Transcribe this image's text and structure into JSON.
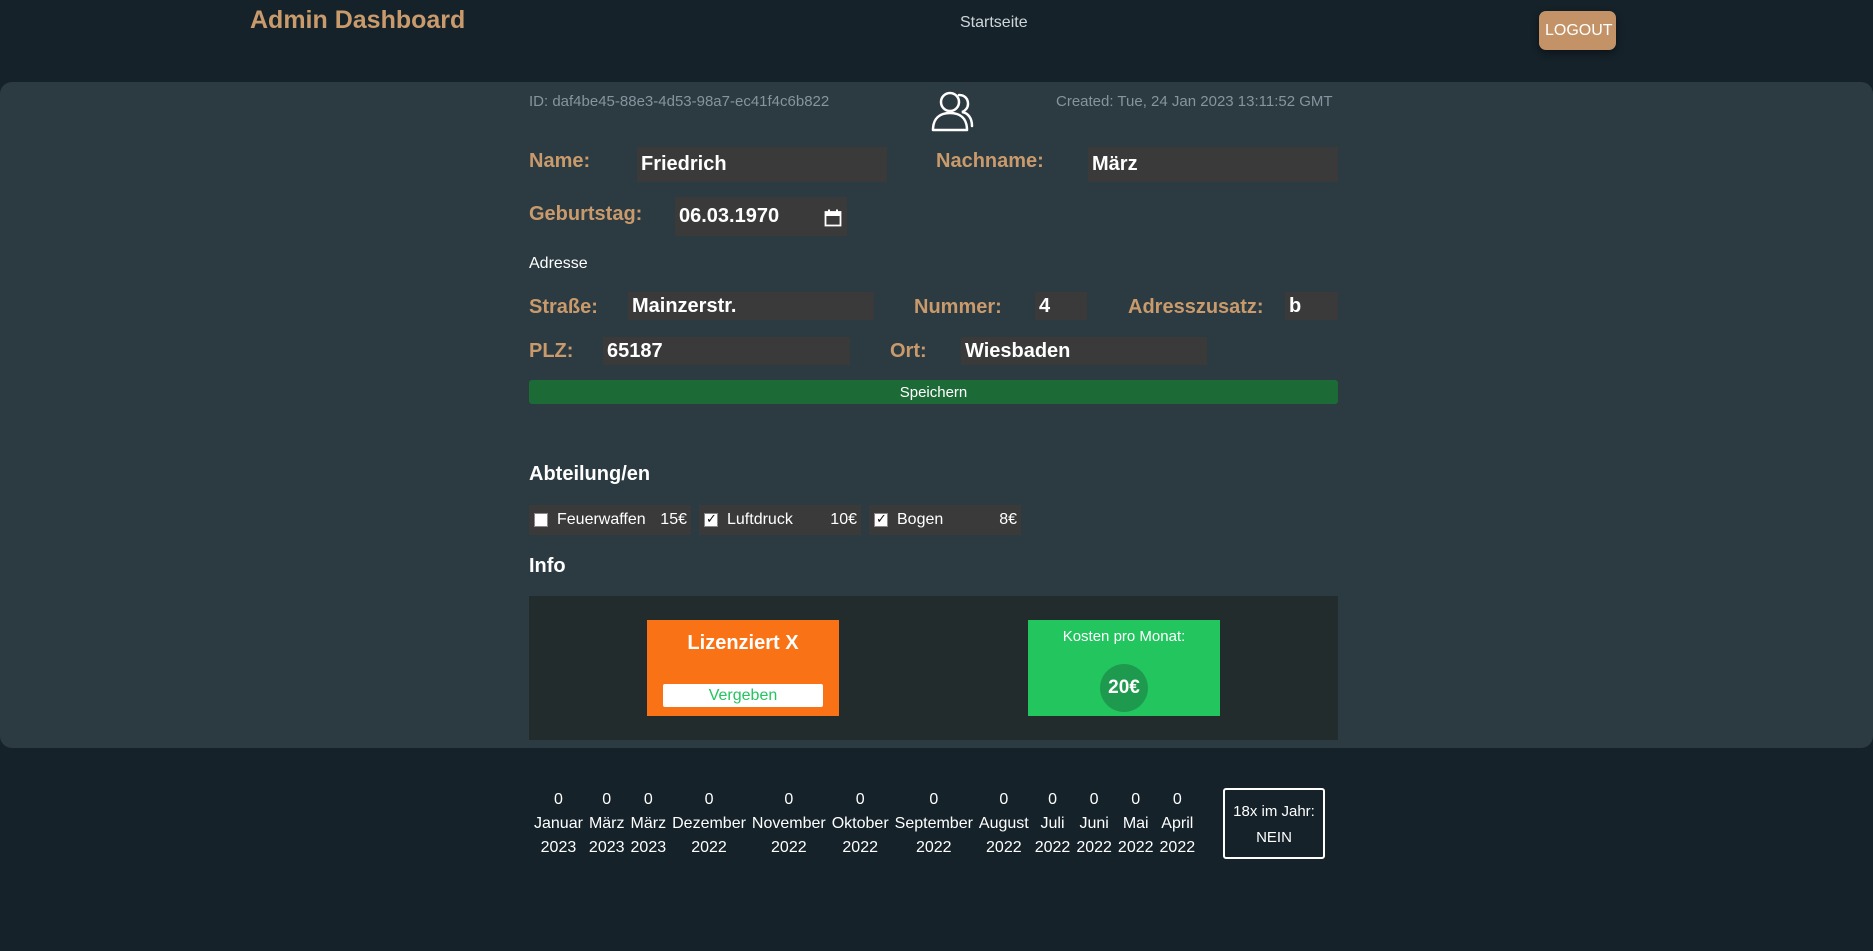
{
  "header": {
    "brand": "Admin Dashboard",
    "nav_home": "Startseite",
    "logout_label": "LOGOUT"
  },
  "record": {
    "id_text": "ID: daf4be45-88e3-4d53-98a7-ec41f4c6b822",
    "created_text": "Created: Tue, 24 Jan 2023 13:11:52 GMT",
    "icon": "users-icon"
  },
  "form": {
    "name_label": "Name:",
    "name_value": "Friedrich",
    "lastname_label": "Nachname:",
    "lastname_value": "März",
    "birthday_label": "Geburtstag:",
    "birthday_value": "06.03.1970",
    "address_heading": "Adresse",
    "street_label": "Straße:",
    "street_value": "Mainzerstr.",
    "number_label": "Nummer:",
    "number_value": "4",
    "addition_label": "Adresszusatz:",
    "addition_value": "b",
    "zip_label": "PLZ:",
    "zip_value": "65187",
    "city_label": "Ort:",
    "city_value": "Wiesbaden",
    "save_label": "Speichern"
  },
  "departments": {
    "heading": "Abteilung/en",
    "items": [
      {
        "name": "Feuerwaffen",
        "price": "15€",
        "checked": false
      },
      {
        "name": "Luftdruck",
        "price": "10€",
        "checked": true
      },
      {
        "name": "Bogen",
        "price": "8€",
        "checked": true
      }
    ]
  },
  "info": {
    "heading": "Info",
    "license_title": "Lizenziert X",
    "license_button": "Vergeben",
    "cost_title": "Kosten pro Monat:",
    "cost_value": "20€"
  },
  "attendance": {
    "months": [
      {
        "count": "0",
        "month": "Januar",
        "year": "2023"
      },
      {
        "count": "0",
        "month": "März",
        "year": "2023"
      },
      {
        "count": "0",
        "month": "März",
        "year": "2023"
      },
      {
        "count": "0",
        "month": "Dezember",
        "year": "2022"
      },
      {
        "count": "0",
        "month": "November",
        "year": "2022"
      },
      {
        "count": "0",
        "month": "Oktober",
        "year": "2022"
      },
      {
        "count": "0",
        "month": "September",
        "year": "2022"
      },
      {
        "count": "0",
        "month": "August",
        "year": "2022"
      },
      {
        "count": "0",
        "month": "Juli",
        "year": "2022"
      },
      {
        "count": "0",
        "month": "Juni",
        "year": "2022"
      },
      {
        "count": "0",
        "month": "Mai",
        "year": "2022"
      },
      {
        "count": "0",
        "month": "April",
        "year": "2022"
      }
    ],
    "year_label": "18x im Jahr:",
    "year_value": "NEIN"
  },
  "colors": {
    "background": "#15222a",
    "panel": "#2c3a42",
    "accent": "#c99a6b",
    "save": "#1c6b37",
    "license": "#f97316",
    "cost": "#22c55e"
  }
}
